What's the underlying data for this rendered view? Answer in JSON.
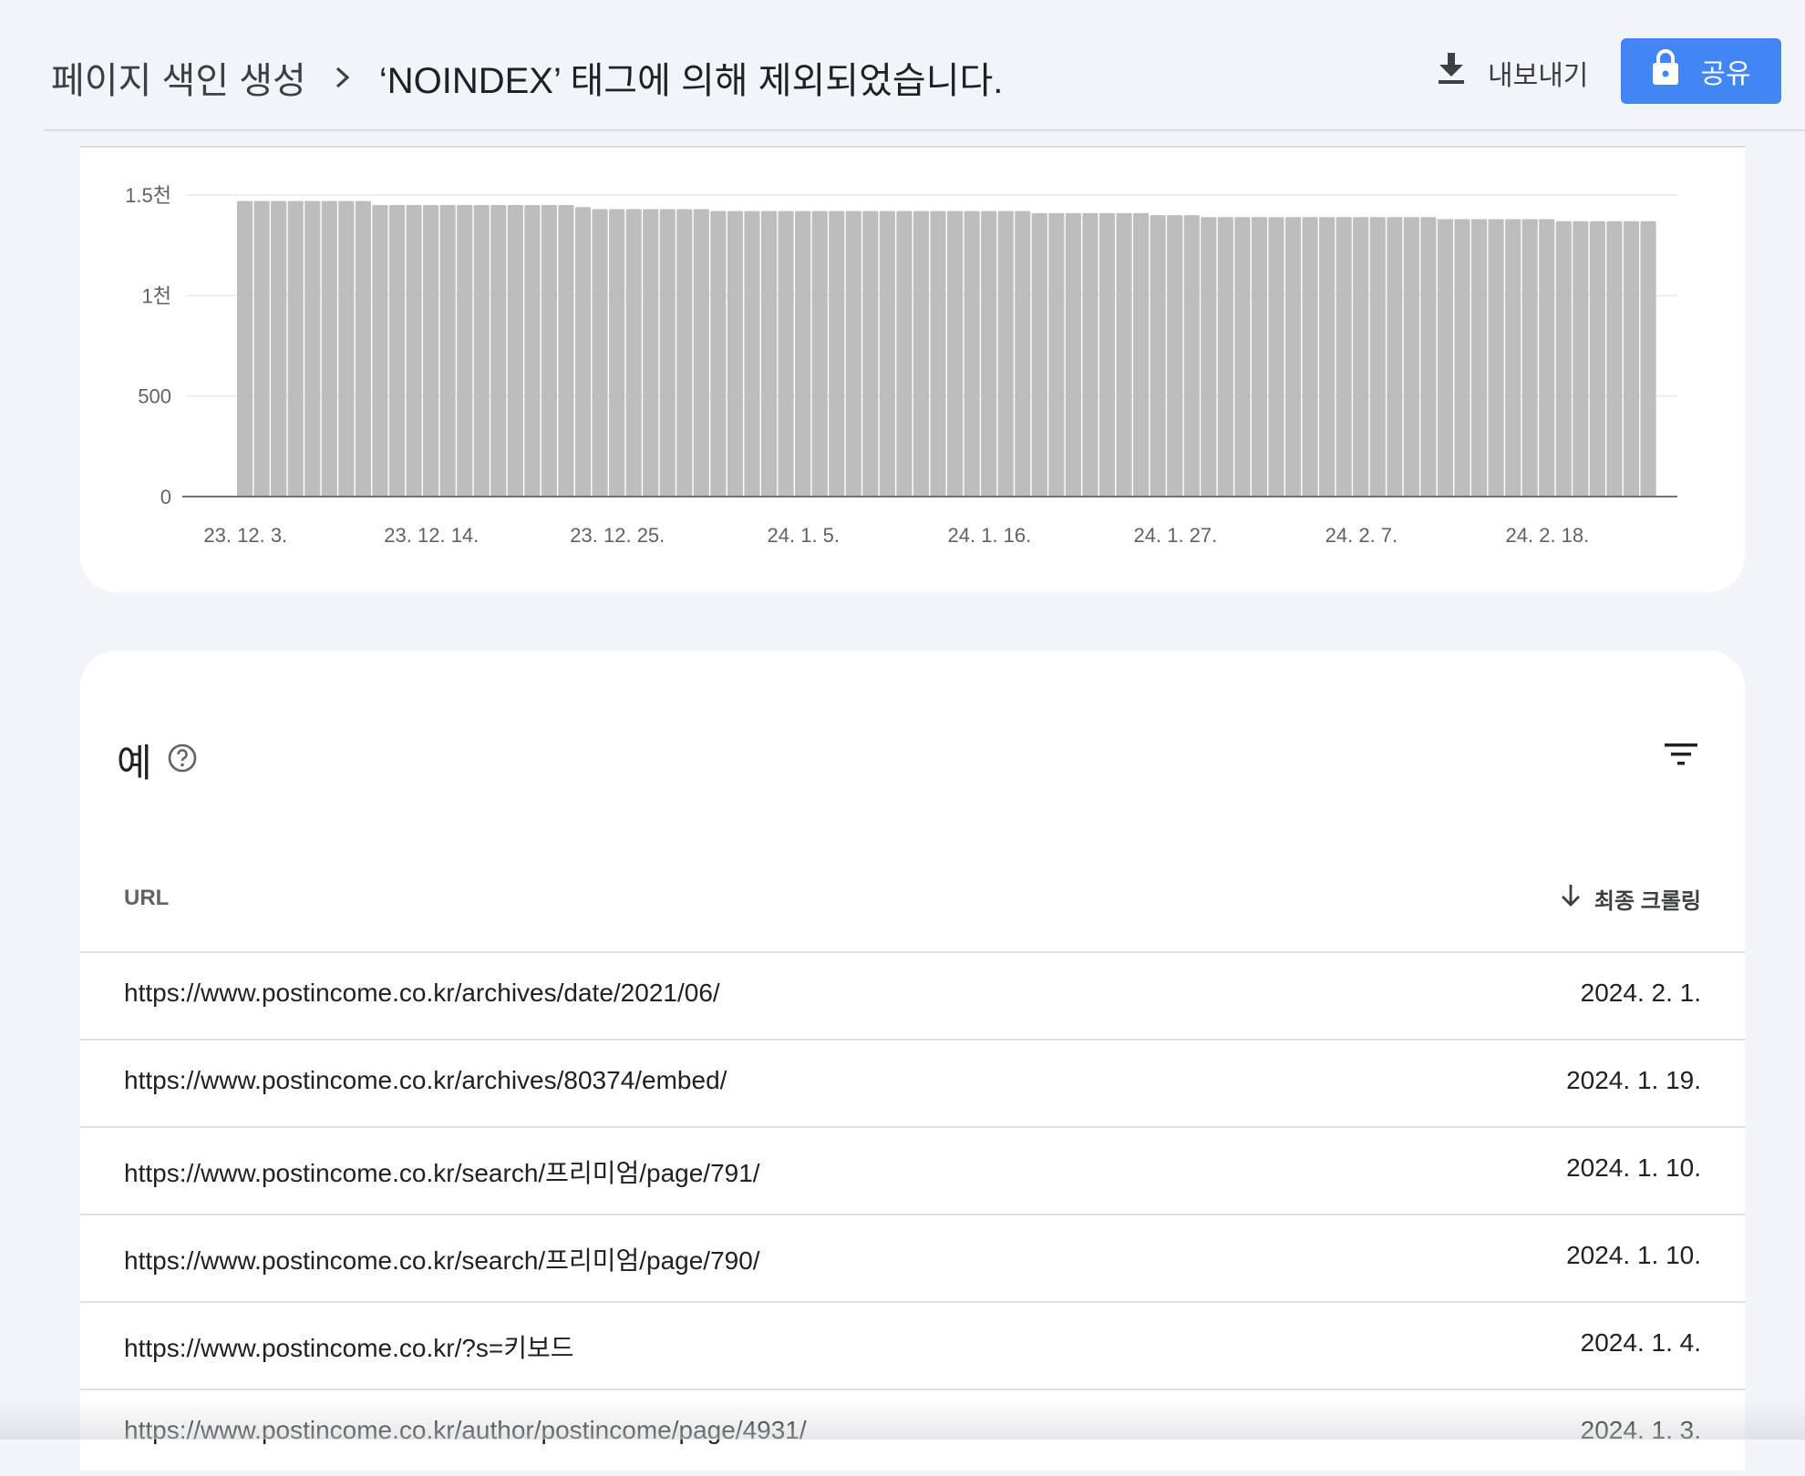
{
  "header": {
    "breadcrumb_root": "페이지 색인 생성",
    "breadcrumb_current": "‘NOINDEX’ 태그에 의해 제외되었습니다.",
    "export_label": "내보내기",
    "share_label": "공유"
  },
  "chart_data": {
    "type": "bar",
    "title": "",
    "xlabel": "",
    "ylabel": "",
    "ylim": [
      0,
      1500
    ],
    "y_ticks": [
      {
        "value": 0,
        "label": "0"
      },
      {
        "value": 500,
        "label": "500"
      },
      {
        "value": 1000,
        "label": "1천"
      },
      {
        "value": 1500,
        "label": "1.5천"
      }
    ],
    "x_tick_labels": [
      "23. 12. 3.",
      "23. 12. 14.",
      "23. 12. 25.",
      "24. 1. 5.",
      "24. 1. 16.",
      "24. 1. 27.",
      "24. 2. 7.",
      "24. 2. 18."
    ],
    "x_tick_indices": [
      0,
      11,
      22,
      33,
      44,
      55,
      66,
      77
    ],
    "series": [
      {
        "values": [
          1470,
          1470,
          1470,
          1470,
          1470,
          1470,
          1470,
          1470,
          1450,
          1450,
          1450,
          1450,
          1450,
          1450,
          1450,
          1450,
          1450,
          1450,
          1450,
          1450,
          1440,
          1430,
          1430,
          1430,
          1430,
          1430,
          1430,
          1430,
          1420,
          1420,
          1420,
          1420,
          1420,
          1420,
          1420,
          1420,
          1420,
          1420,
          1420,
          1420,
          1420,
          1420,
          1420,
          1420,
          1420,
          1420,
          1420,
          1410,
          1410,
          1410,
          1410,
          1410,
          1410,
          1410,
          1400,
          1400,
          1400,
          1390,
          1390,
          1390,
          1390,
          1390,
          1390,
          1390,
          1390,
          1390,
          1390,
          1390,
          1390,
          1390,
          1390,
          1380,
          1380,
          1380,
          1380,
          1380,
          1380,
          1380,
          1370,
          1370,
          1370,
          1370,
          1370,
          1370
        ]
      }
    ],
    "bar_color": "#bdbdbd",
    "grid": true
  },
  "examples": {
    "title": "예",
    "columns": {
      "url": "URL",
      "last_crawl": "최종 크롤링"
    },
    "rows": [
      {
        "url": "https://www.postincome.co.kr/archives/date/2021/06/",
        "date": "2024. 2. 1."
      },
      {
        "url": "https://www.postincome.co.kr/archives/80374/embed/",
        "date": "2024. 1. 19."
      },
      {
        "url": "https://www.postincome.co.kr/search/프리미엄/page/791/",
        "date": "2024. 1. 10."
      },
      {
        "url": "https://www.postincome.co.kr/search/프리미엄/page/790/",
        "date": "2024. 1. 10."
      },
      {
        "url": "https://www.postincome.co.kr/?s=키보드",
        "date": "2024. 1. 4."
      },
      {
        "url": "https://www.postincome.co.kr/author/postincome/page/4931/",
        "date": "2024. 1. 3."
      }
    ]
  },
  "colors": {
    "accent": "#4285f4",
    "page_bg": "#f1f4f9"
  }
}
